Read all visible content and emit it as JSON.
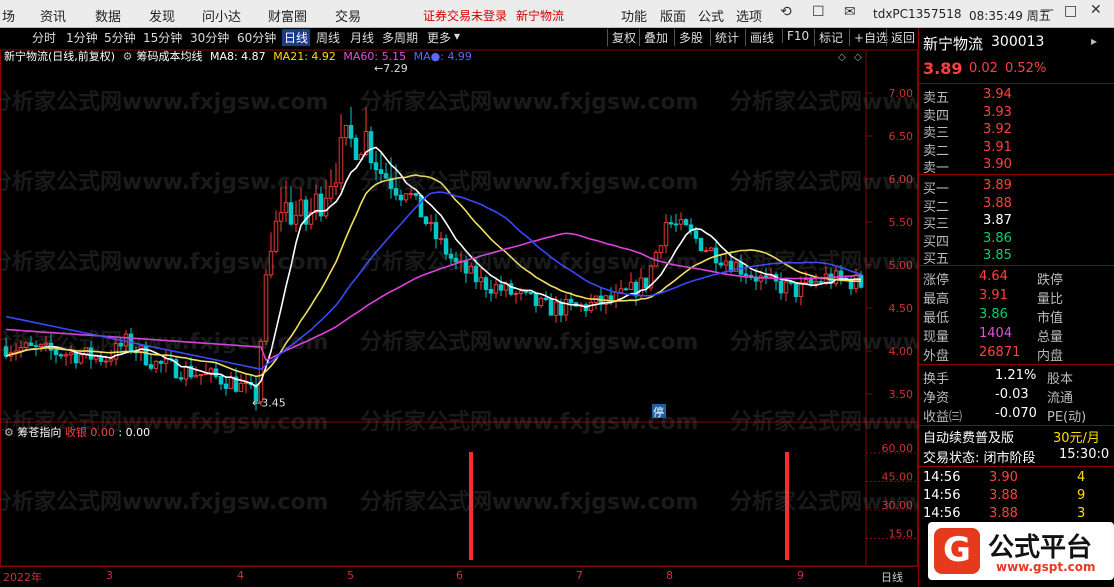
{
  "top_menu": [
    "场",
    "资讯",
    "数据",
    "发现",
    "问小达",
    "财富圈",
    "交易"
  ],
  "login_notice": "证券交易未登录",
  "stock_link": "新宁物流",
  "top_menu_right": [
    "功能",
    "版面",
    "公式",
    "选项"
  ],
  "account": "tdxPC1357518",
  "clock": "08:35:49 周五",
  "periods": [
    "分时",
    "1分钟",
    "5分钟",
    "15分钟",
    "30分钟",
    "60分钟",
    "日线",
    "周线",
    "月线",
    "多周期",
    "更多"
  ],
  "period_active": "日线",
  "toolbar": [
    "复权",
    "叠加",
    "多股",
    "统计",
    "画线",
    "F10",
    "标记",
    "+自选",
    "返回"
  ],
  "chart_title": "新宁物流(日线,前复权)",
  "indicator_name": "筹码成本均线",
  "ma": {
    "ma8": "MA8: 4.87",
    "ma21": "MA21: 4.92",
    "ma60": "MA60: 5.15",
    "ma_x": "MA●: 4.99"
  },
  "annotations": {
    "high": "7.29",
    "low": "3.45",
    "limit": "停"
  },
  "price_axis": [
    "7.00",
    "6.50",
    "6.00",
    "5.50",
    "5.00",
    "4.50",
    "4.00",
    "3.50"
  ],
  "ind_title": "筹苍指向",
  "ind_label": "收银",
  "ind_value1": "0.00",
  "ind_value2": "0.00",
  "ind_axis": [
    "60.00",
    "45.00",
    "30.00",
    "15.0"
  ],
  "watermark": "分析家公式网www.fxjgsw.com",
  "watermark2": "www.gspt.com",
  "dates": {
    "year": "2022年",
    "m3": "3",
    "m4": "4",
    "m5": "5",
    "m6": "6",
    "m7": "7",
    "m8": "8",
    "m9": "9"
  },
  "date_tab": "日线",
  "stock": {
    "name": "新宁物流",
    "code": "300013",
    "price": "3.89",
    "change": "0.02",
    "pct": "0.52%"
  },
  "asks": [
    {
      "label": "卖五",
      "price": "3.94"
    },
    {
      "label": "卖四",
      "price": "3.93"
    },
    {
      "label": "卖三",
      "price": "3.92"
    },
    {
      "label": "卖二",
      "price": "3.91"
    },
    {
      "label": "卖一",
      "price": "3.90"
    }
  ],
  "bids": [
    {
      "label": "买一",
      "price": "3.89"
    },
    {
      "label": "买二",
      "price": "3.88"
    },
    {
      "label": "买三",
      "price": "3.87"
    },
    {
      "label": "买四",
      "price": "3.86"
    },
    {
      "label": "买五",
      "price": "3.85"
    }
  ],
  "stats": [
    {
      "label": "涨停",
      "value": "4.64",
      "right": "跌停"
    },
    {
      "label": "最高",
      "value": "3.91",
      "right": "量比"
    },
    {
      "label": "最低",
      "value": "3.86",
      "right": "市值"
    },
    {
      "label": "现量",
      "value": "1404",
      "right": "总量"
    },
    {
      "label": "外盘",
      "value": "26871",
      "right": "内盘"
    }
  ],
  "stats2": [
    {
      "label": "换手",
      "value": "1.21%",
      "right": "股本"
    },
    {
      "label": "净资",
      "value": "-0.03",
      "right": "流通"
    },
    {
      "label": "收益㈢",
      "value": "-0.070",
      "right": "PE(动)"
    }
  ],
  "promo": "自动续费普及版",
  "promo_price": "30元/月",
  "trade_status": "交易状态: 闭市阶段",
  "trade_time": "15:30:0",
  "ticks": [
    {
      "time": "14:56",
      "price": "3.90",
      "vol": "4"
    },
    {
      "time": "14:56",
      "price": "3.88",
      "vol": "9"
    },
    {
      "time": "14:56",
      "price": "3.88",
      "vol": "3"
    }
  ],
  "brand": {
    "title": "公式平台",
    "url": "www.gspt.com"
  },
  "colors": {
    "up": "#ff3b3b",
    "down": "#00c8c8",
    "ma8": "#ffffff",
    "ma21": "#f0e060",
    "ma60": "#e040e0",
    "ma_x": "#3a48ff",
    "accent": "#8b0000"
  }
}
